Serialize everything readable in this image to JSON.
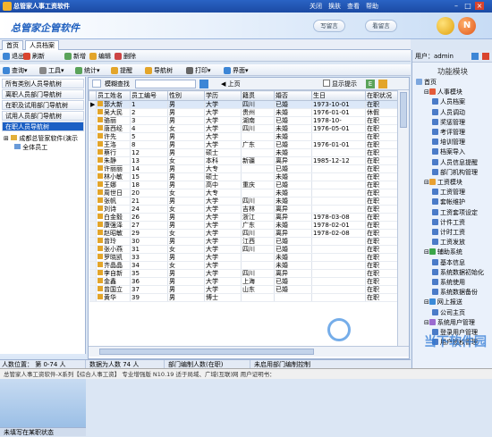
{
  "window": {
    "title": "总管家人事工资软件",
    "menu": [
      "关闭",
      "换肤",
      "查看",
      "帮助"
    ]
  },
  "banner": {
    "brand": "总管家企管软件",
    "btn1": "写留言",
    "btn2": "看留言"
  },
  "tabs": [
    "首页",
    "人员档案"
  ],
  "toolbar1": [
    "退出",
    "刷新",
    "新增",
    "编辑",
    "删除"
  ],
  "toolbar2": [
    "查询",
    "工具",
    "统计",
    "提醒",
    "导航树",
    "打印",
    "界面"
  ],
  "left_items": [
    "所有类别人员导航树",
    "离职人员部门导航树",
    "在职及试用部门导航树",
    "试用人员部门导航树",
    "在职人员导航树"
  ],
  "left_tree": [
    "成都总管家软件(演示",
    "全体员工"
  ],
  "left_footer": "未填写在某职状态",
  "grid_tools": {
    "search_label": "模糊查找",
    "prev": "上页",
    "show_tip": "显示提示",
    "col_btn": "E"
  },
  "columns": [
    "员工姓名",
    "员工编号",
    "性别",
    "学历",
    "籍贯",
    "婚否",
    "生日",
    "在职状况"
  ],
  "rows": [
    [
      "郭大新",
      "1",
      "男",
      "大学",
      "四川",
      "已婚",
      "1973-10-01",
      "在职"
    ],
    [
      "吴大民",
      "2",
      "男",
      "大学",
      "贵州",
      "未婚",
      "1976-01-01",
      "休假"
    ],
    [
      "骆丽",
      "3",
      "男",
      "大学",
      "湖南",
      "已婚",
      "1978-10-",
      "在职"
    ],
    [
      "唐西经",
      "4",
      "女",
      "大学",
      "四川",
      "未婚",
      "1976-05-01",
      "在职"
    ],
    [
      "许先",
      "5",
      "男",
      "大学",
      "",
      "未婚",
      "",
      "在职"
    ],
    [
      "王洛",
      "8",
      "男",
      "大学",
      "广东",
      "已婚",
      "1976-01-01",
      "在职"
    ],
    [
      "蔡行",
      "12",
      "男",
      "硕士",
      "",
      "未婚",
      "",
      "在职"
    ],
    [
      "朱静",
      "13",
      "女",
      "本科",
      "新疆",
      "离异",
      "1985-12-12",
      "在职"
    ],
    [
      "许丽丽",
      "14",
      "男",
      "大专",
      "",
      "已婚",
      "",
      "在职"
    ],
    [
      "林小敏",
      "15",
      "男",
      "硕士",
      "",
      "未婚",
      "",
      "在职"
    ],
    [
      "王娜",
      "18",
      "男",
      "高中",
      "重庆",
      "已婚",
      "",
      "在职"
    ],
    [
      "周世日",
      "20",
      "女",
      "大专",
      "",
      "未婚",
      "",
      "在职"
    ],
    [
      "张帆",
      "21",
      "男",
      "大学",
      "四川",
      "未婚",
      "",
      "在职"
    ],
    [
      "刘诗",
      "24",
      "女",
      "大学",
      "吉林",
      "离异",
      "",
      "在职"
    ],
    [
      "白金毅",
      "26",
      "男",
      "大学",
      "浙江",
      "离异",
      "1978-03-08",
      "在职"
    ],
    [
      "康强泽",
      "27",
      "男",
      "大学",
      "广东",
      "未婚",
      "1978-02-01",
      "在职"
    ],
    [
      "赵昭敏",
      "29",
      "女",
      "大学",
      "四川",
      "离异",
      "1978-02-08",
      "在职"
    ],
    [
      "曾玲",
      "30",
      "男",
      "大学",
      "江西",
      "已婚",
      "",
      "在职"
    ],
    [
      "张小燕",
      "31",
      "女",
      "大学",
      "四川",
      "已婚",
      "",
      "在职"
    ],
    [
      "罗晓凯",
      "33",
      "男",
      "大学",
      "",
      "未婚",
      "",
      "在职"
    ],
    [
      "齐晶晶",
      "34",
      "女",
      "大学",
      "",
      "未婚",
      "",
      "在职"
    ],
    [
      "李自新",
      "35",
      "男",
      "大学",
      "四川",
      "离异",
      "",
      "在职"
    ],
    [
      "金鑫",
      "36",
      "男",
      "大学",
      "上海",
      "已婚",
      "",
      "在职"
    ],
    [
      "曾国立",
      "37",
      "男",
      "大学",
      "山东",
      "已婚",
      "",
      "在职"
    ],
    [
      "黄华",
      "39",
      "男",
      "博士",
      "",
      "",
      "",
      "在职"
    ]
  ],
  "status": {
    "range": "人数位置：  第 0-74 人",
    "count": "数据为人数 74 人",
    "dept": "部门编制人数(在职)",
    "unset": "未启用部门编制控制"
  },
  "user": {
    "label": "用户：",
    "name": "admin"
  },
  "func_title": "功能模块",
  "right_tree": [
    {
      "label": "首页",
      "indent": 0,
      "color": "#7da7de"
    },
    {
      "label": "人事模块",
      "indent": 1,
      "color": "#e35b3a"
    },
    {
      "label": "人员档案",
      "indent": 2,
      "color": "#4a7bc8"
    },
    {
      "label": "人员调动",
      "indent": 2,
      "color": "#4a7bc8"
    },
    {
      "label": "奖惩管理",
      "indent": 2,
      "color": "#4a7bc8"
    },
    {
      "label": "考评管理",
      "indent": 2,
      "color": "#4a7bc8"
    },
    {
      "label": "培训管理",
      "indent": 2,
      "color": "#4a7bc8"
    },
    {
      "label": "档案导入",
      "indent": 2,
      "color": "#4a7bc8"
    },
    {
      "label": "人员信息提醒",
      "indent": 2,
      "color": "#4a7bc8"
    },
    {
      "label": "部门机构管理",
      "indent": 2,
      "color": "#4a7bc8"
    },
    {
      "label": "工资模块",
      "indent": 1,
      "color": "#e8a030"
    },
    {
      "label": "工资管理",
      "indent": 2,
      "color": "#4a7bc8"
    },
    {
      "label": "套帐维护",
      "indent": 2,
      "color": "#4a7bc8"
    },
    {
      "label": "工资套项设定",
      "indent": 2,
      "color": "#4a7bc8"
    },
    {
      "label": "计件工资",
      "indent": 2,
      "color": "#4a7bc8"
    },
    {
      "label": "计时工资",
      "indent": 2,
      "color": "#4a7bc8"
    },
    {
      "label": "工资发放",
      "indent": 2,
      "color": "#4a7bc8"
    },
    {
      "label": "辅助系统",
      "indent": 1,
      "color": "#3aa64a"
    },
    {
      "label": "基本信息",
      "indent": 2,
      "color": "#4a7bc8"
    },
    {
      "label": "系统数据初始化",
      "indent": 2,
      "color": "#4a7bc8"
    },
    {
      "label": "系统使用",
      "indent": 2,
      "color": "#4a7bc8"
    },
    {
      "label": "系统数据备份",
      "indent": 2,
      "color": "#4a7bc8"
    },
    {
      "label": "网上报送",
      "indent": 1,
      "color": "#3a8ad8"
    },
    {
      "label": "公司主页",
      "indent": 2,
      "color": "#4a7bc8"
    },
    {
      "label": "系统用户管理",
      "indent": 1,
      "color": "#9a6ad0"
    },
    {
      "label": "登录用户管理",
      "indent": 2,
      "color": "#4a7bc8"
    },
    {
      "label": "用户授权管理",
      "indent": 2,
      "color": "#4a7bc8"
    }
  ],
  "footer": "总管家人事工资软件-X系列【综合人事工资】  专业增强版 N10.19 适于局域、广域(互联)网 用户证明书：",
  "watermark": "当下软件园"
}
